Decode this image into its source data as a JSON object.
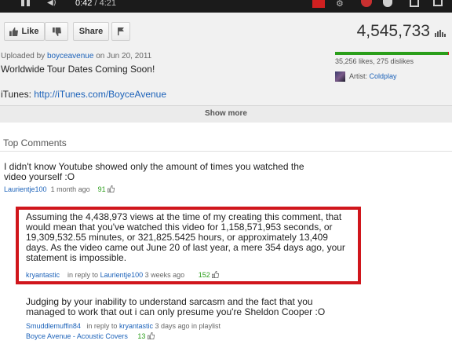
{
  "player": {
    "current_time": "0:42",
    "duration": "4:21",
    "separator": " / "
  },
  "actions": {
    "like_label": "Like",
    "share_label": "Share",
    "view_count": "4,545,733"
  },
  "description": {
    "uploaded_prefix": "Uploaded by ",
    "uploader": "boyceavenue",
    "uploaded_on": " on Jun 20, 2011",
    "title": "Worldwide Tour Dates Coming Soon!",
    "itunes_label": "iTunes: ",
    "itunes_url": "http://iTunes.com/BoyceAvenue",
    "ratings": "35,256 likes, 275 dislikes",
    "like_fraction": 0.992,
    "artist_label": "Artist: ",
    "artist": "Coldplay",
    "show_more": "Show more"
  },
  "comments": {
    "header": "Top Comments",
    "items": [
      {
        "text": "I didn't know Youtube showed only the amount of times you watched the video yourself :O",
        "author": "Laurientje100",
        "time": "1 month ago",
        "score": "91"
      },
      {
        "text": "Assuming the 4,438,973 views at the time of my creating this comment, that would mean that you've watched this video for 1,158,571,953 seconds, or 19,309,532.55 minutes, or 321,825.5425 hours, or approximately 13,409 days. As the video came out June 20 of last year, a mere 354 days ago, your statement is impossible.",
        "author": "kryantastic",
        "reply_prefix": "in reply to",
        "reply_to": "Laurientje100",
        "time": "3 weeks ago",
        "score": "152"
      },
      {
        "text": "Judging by your inability to understand sarcasm and the fact that you managed to work that out i can only presume you're Sheldon Cooper :O",
        "author": "Smuddlemuffin84",
        "reply_prefix": "in reply to",
        "reply_to": "kryantastic",
        "time": "3 days ago",
        "playlist_prefix": "in playlist",
        "playlist": "Boyce Avenue - Acoustic Covers",
        "score": "13"
      }
    ]
  },
  "colors": {
    "link": "#1c62b9",
    "positive": "#2a9e1a",
    "negative": "#cc1f1f",
    "highlight": "#d0161c"
  }
}
